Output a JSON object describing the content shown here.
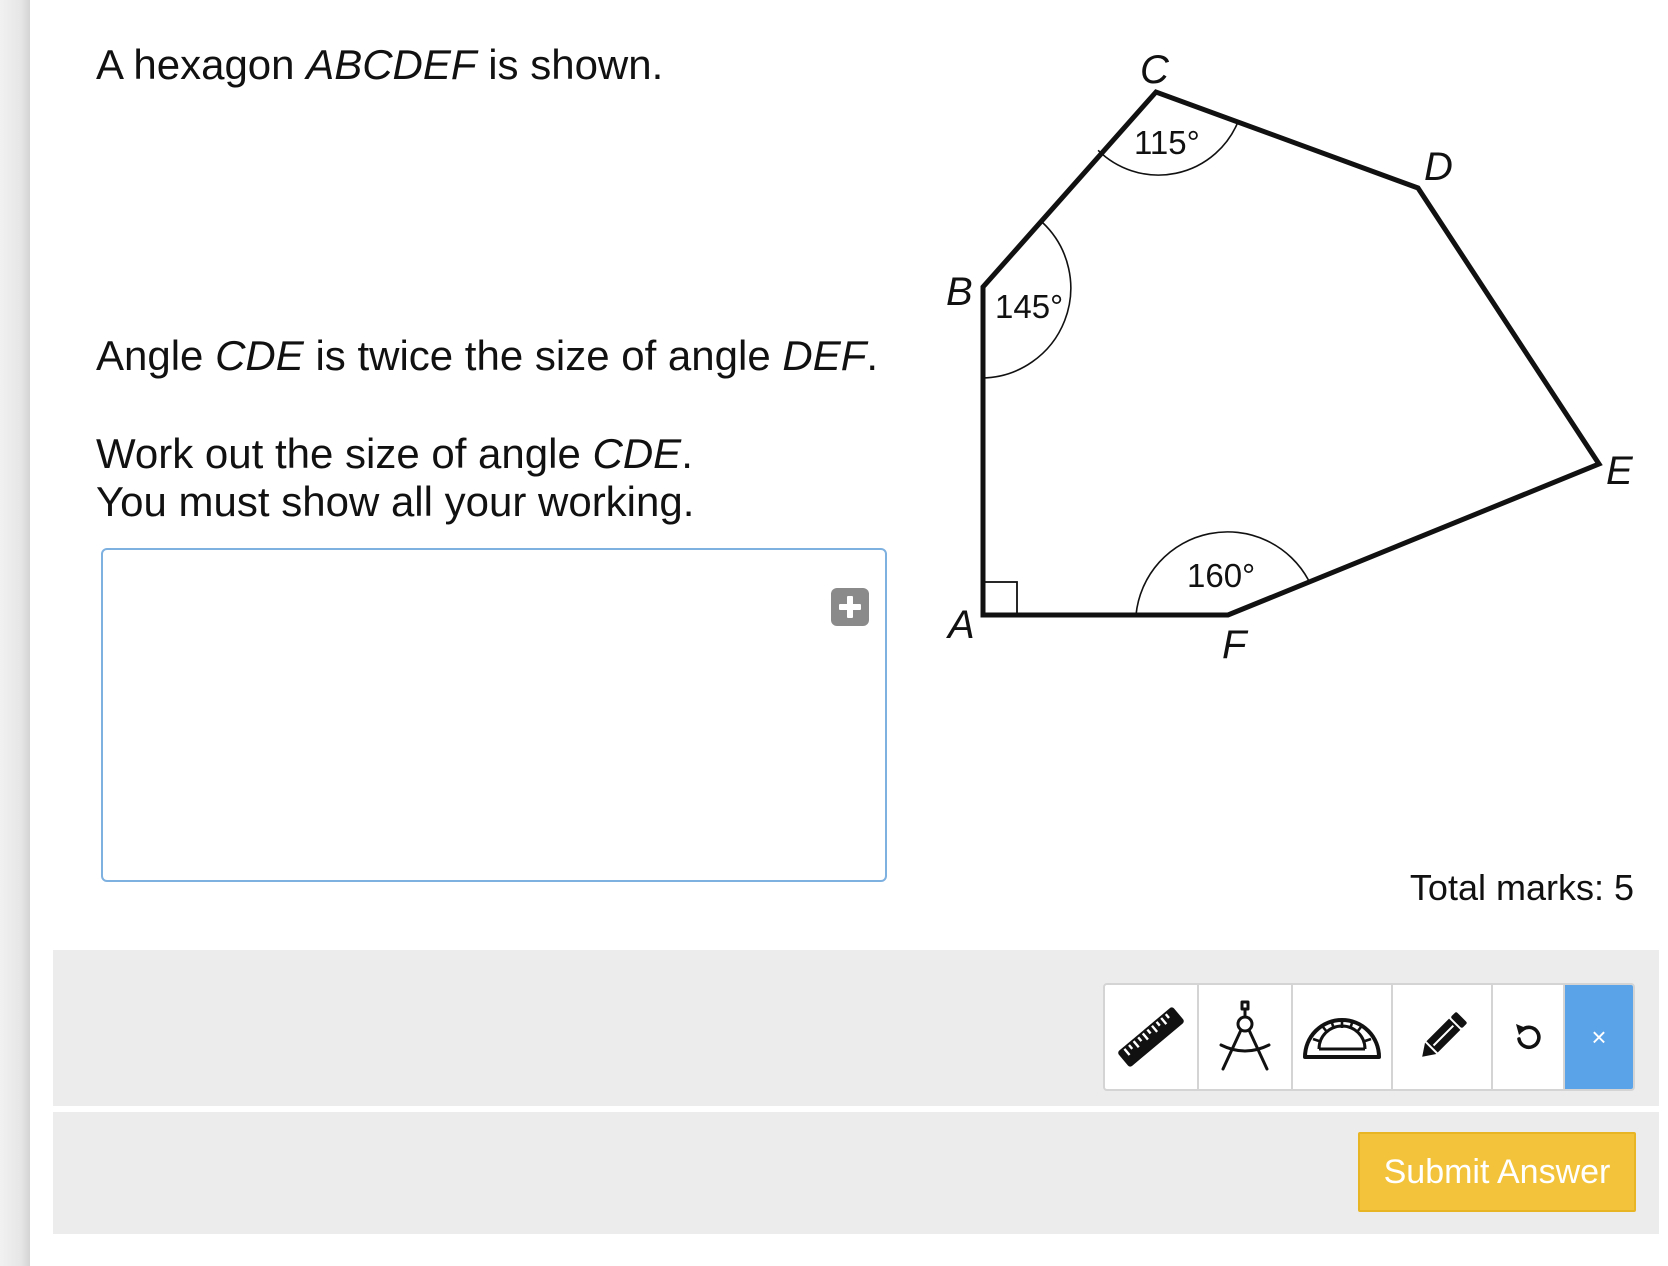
{
  "question": {
    "line1": {
      "pre": "A hexagon ",
      "em": "ABCDEF",
      "post": " is shown."
    },
    "line2": {
      "pre": "Angle ",
      "em1": "CDE",
      "mid": " is twice the size of angle ",
      "em2": "DEF",
      "post": "."
    },
    "line3": {
      "pre": "Work out the size of angle ",
      "em": "CDE",
      "post": "."
    },
    "line4": "You must show all your working."
  },
  "figure": {
    "vertices": {
      "A": "A",
      "B": "B",
      "C": "C",
      "D": "D",
      "E": "E",
      "F": "F"
    },
    "angles": {
      "C": "115°",
      "B": "145°",
      "F": "160°"
    }
  },
  "answer_box": {
    "add_icon": "plus-icon"
  },
  "total_marks": "Total marks: 5",
  "toolbar": {
    "tools": [
      "ruler-icon",
      "compass-icon",
      "protractor-icon",
      "pencil-icon",
      "undo-icon"
    ],
    "close_label": "×"
  },
  "submit_label": "Submit Answer",
  "colors": {
    "submit": "#f3c43b",
    "close": "#5aa3e8",
    "answer_border": "#7fb1e0",
    "panel": "#ececec"
  }
}
